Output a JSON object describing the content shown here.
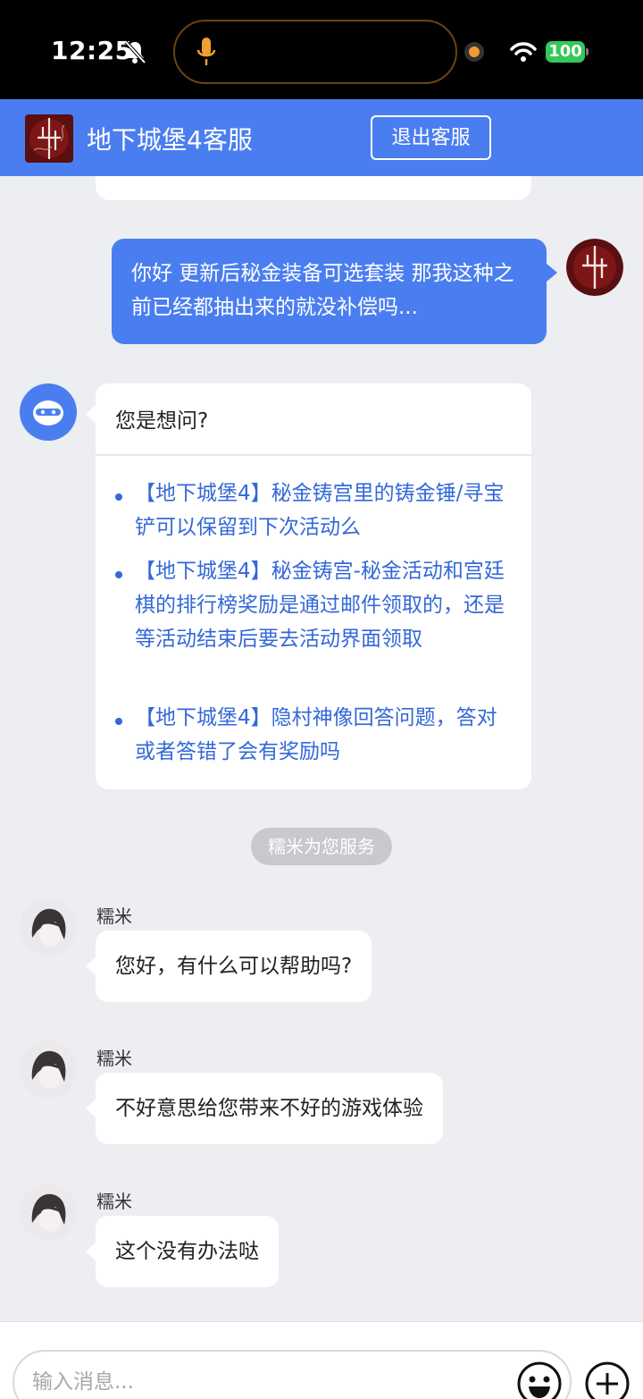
{
  "status_bar": {
    "time": "12:25",
    "battery": "100"
  },
  "header": {
    "title": "地下城堡4客服",
    "exit_label": "退出客服"
  },
  "messages": {
    "user_message": "你好 更新后秘金装备可选套装 那我这种之前已经都抽出来的就没补偿吗...",
    "bot_question": "您是想问?",
    "suggestions": [
      "【地下城堡4】秘金铸宫里的铸金锤/寻宝铲可以保留到下次活动么",
      "【地下城堡4】秘金铸宫-秘金活动和宫廷棋的排行榜奖励是通过邮件领取的，还是等活动结束后要去活动界面领取",
      "【地下城堡4】隐村神像回答问题，答对或者答错了会有奖励吗"
    ],
    "system_notice": "糯米为您服务",
    "agent_replies": [
      {
        "name": "糯米",
        "text": "您好，有什么可以帮助吗?"
      },
      {
        "name": "糯米",
        "text": "不好意思给您带来不好的游戏体验"
      },
      {
        "name": "糯米",
        "text": "这个没有办法哒"
      }
    ]
  },
  "input": {
    "placeholder": "输入消息..."
  },
  "icons": {
    "bell": "bell-slash-icon",
    "mic": "microphone-icon",
    "wifi": "wifi-icon",
    "emoji": "smiley-icon",
    "plus": "plus-circle-icon"
  },
  "colors": {
    "accent": "#4a7ef0",
    "link": "#3468d8",
    "background": "#edeef1"
  }
}
